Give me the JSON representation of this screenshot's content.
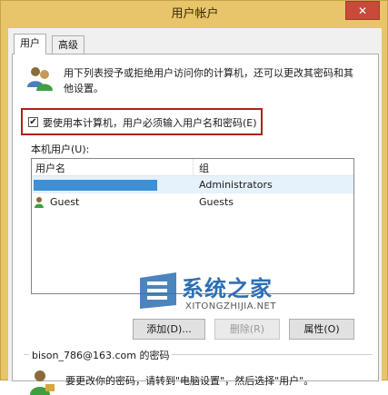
{
  "window": {
    "title": "用户帐户",
    "close_label": "✕"
  },
  "tabs": [
    {
      "label": "用户"
    },
    {
      "label": "高级"
    }
  ],
  "description": "用下列表授予或拒绝用户访问你的计算机，还可以更改其密码和其他设置。",
  "checkbox": {
    "label": "要使用本计算机，用户必须输入用户名和密码(E)",
    "checked": true,
    "mark": "✔"
  },
  "local_users": {
    "label": "本机用户(U):",
    "columns": [
      "用户名",
      "组"
    ],
    "rows": [
      {
        "name": "",
        "group": "Administrators",
        "selected": true
      },
      {
        "name": "Guest",
        "group": "Guests",
        "selected": false
      }
    ]
  },
  "buttons": {
    "add": "添加(D)...",
    "delete": "删除(R)",
    "properties": "属性(O)"
  },
  "password": {
    "title": "bison_786@163.com 的密码",
    "text": "要更改你的密码，请转到\"电脑设置\"，然后选择\"用户\"。"
  },
  "watermark": {
    "title": "系统之家",
    "subtitle": "XITONGZHIJIA.NET"
  },
  "colors": {
    "accent_border": "#b11f1f",
    "selected_bar": "#3d8fd6",
    "window_frame": "#e8c56a"
  }
}
